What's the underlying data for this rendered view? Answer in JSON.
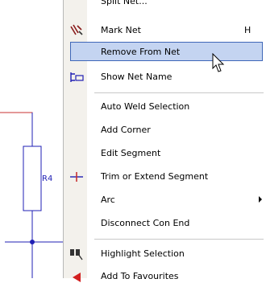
{
  "schematic": {
    "ref_label": "R4",
    "wire_color": "#c83232",
    "component_color": "#1f1fb4"
  },
  "context_menu": {
    "highlight_color": "#c4d4f1",
    "items": [
      {
        "label": "Split Net...",
        "icon": "split-net-icon"
      },
      {
        "label": "Mark Net",
        "shortcut": "H",
        "icon": "mark-net-icon"
      },
      {
        "label": "Remove From Net",
        "highlighted": true
      },
      {
        "label": "Show Net Name",
        "icon": "show-net-name-icon"
      },
      {
        "label": "Auto Weld Selection"
      },
      {
        "label": "Add Corner"
      },
      {
        "label": "Edit Segment"
      },
      {
        "label": "Trim or Extend Segment",
        "icon": "trim-extend-icon"
      },
      {
        "label": "Arc",
        "submenu": true
      },
      {
        "label": "Disconnect Con End"
      },
      {
        "label": "Highlight Selection",
        "icon": "highlight-selection-icon"
      },
      {
        "label": "Add To Favourites",
        "icon": "favourites-icon"
      }
    ]
  }
}
